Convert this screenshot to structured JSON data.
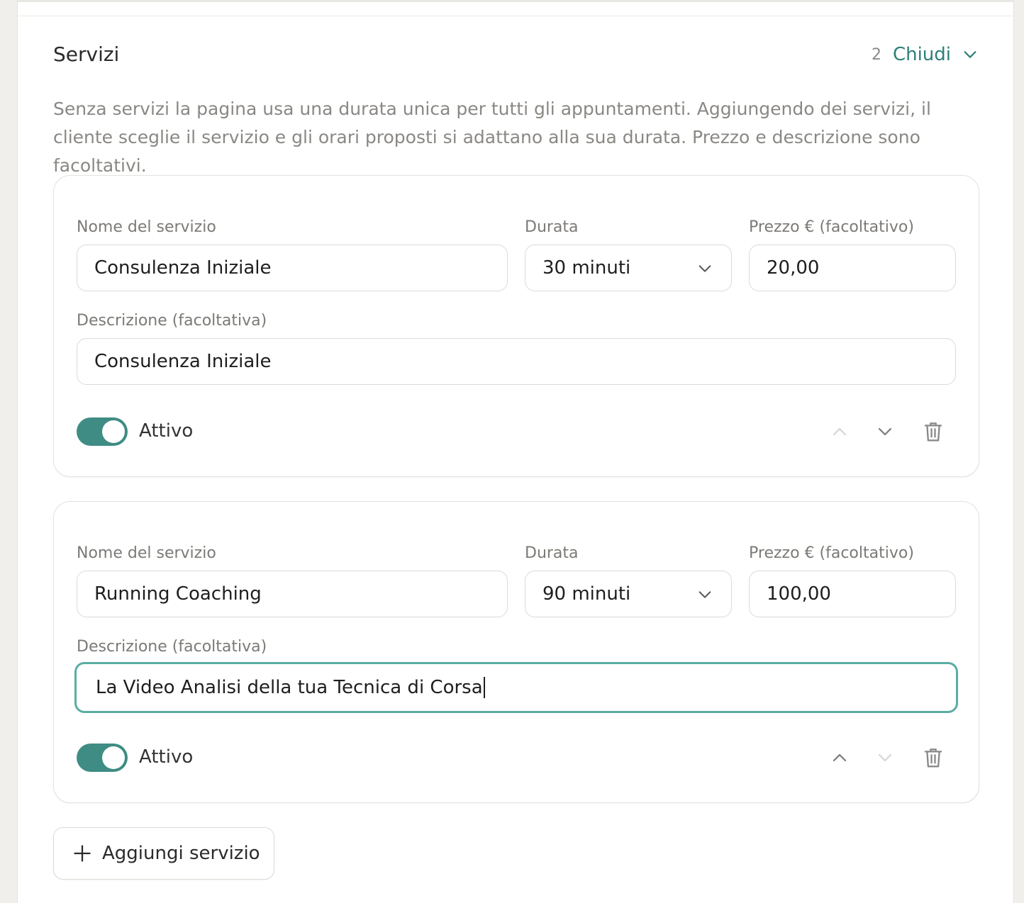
{
  "section": {
    "title": "Servizi",
    "count": "2",
    "toggle_label": "Chiudi",
    "description": "Senza servizi la pagina usa una durata unica per tutti gli appuntamenti. Aggiungendo dei servizi, il cliente sceglie il servizio e gli orari proposti si adattano alla sua durata. Prezzo e descrizione sono facoltativi."
  },
  "labels": {
    "name": "Nome del servizio",
    "duration": "Durata",
    "price": "Prezzo € (facoltativo)",
    "description": "Descrizione (facoltativa)",
    "active": "Attivo"
  },
  "services": [
    {
      "name": "Consulenza Iniziale",
      "duration": "30 minuti",
      "price": "20,00",
      "description": "Consulenza Iniziale",
      "active": true
    },
    {
      "name": "Running Coaching",
      "duration": "90 minuti",
      "price": "100,00",
      "description": "La Video Analisi della tua Tecnica di Corsa",
      "active": true
    }
  ],
  "add_button": {
    "label": "Aggiungi servizio"
  },
  "colors": {
    "accent": "#3f8c84",
    "focus_border": "#5aada3",
    "link": "#2e7f78"
  },
  "icons": {
    "collapse": "chevron-down-icon",
    "select": "chevron-down-icon",
    "move_up": "chevron-up-icon",
    "move_down": "chevron-down-icon",
    "delete": "trash-icon",
    "add": "plus-icon"
  }
}
